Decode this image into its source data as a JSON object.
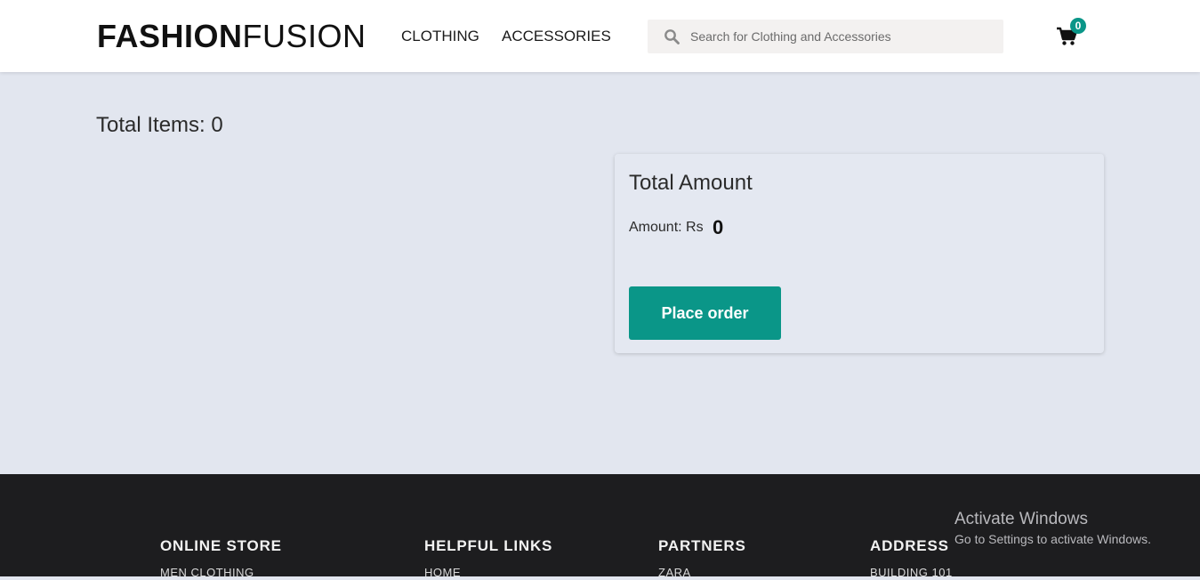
{
  "header": {
    "logo_bold": "FASHION",
    "logo_light": "FUSION",
    "nav": [
      "CLOTHING",
      "ACCESSORIES"
    ],
    "search_placeholder": "Search for Clothing and Accessories",
    "cart_count": "0"
  },
  "main": {
    "total_items_label": "Total Items: 0",
    "summary": {
      "title": "Total Amount",
      "amount_label": "Amount: Rs",
      "amount_value": "0",
      "place_order_label": "Place order"
    }
  },
  "footer": {
    "columns": [
      {
        "heading": "ONLINE STORE",
        "first_link": "MEN CLOTHING"
      },
      {
        "heading": "HELPFUL LINKS",
        "first_link": "HOME"
      },
      {
        "heading": "PARTNERS",
        "first_link": "ZARA"
      },
      {
        "heading": "ADDRESS",
        "first_link": "BUILDING 101"
      }
    ]
  },
  "watermark": {
    "title": "Activate Windows",
    "subtitle": "Go to Settings to activate Windows."
  },
  "colors": {
    "accent": "#0a9688",
    "page_bg": "#e2e6ef",
    "footer_bg": "#1d1d1f"
  },
  "icons": {
    "search": "search-icon",
    "cart": "cart-icon"
  }
}
